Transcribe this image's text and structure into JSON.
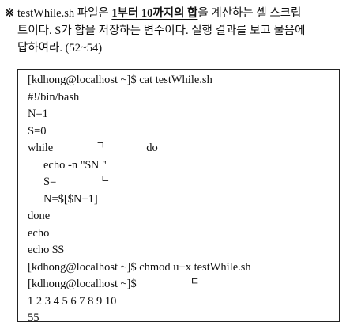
{
  "question": {
    "mark": "※",
    "line1_pre": "testWhile.sh 파일은 ",
    "line1_emph": "1부터 10까지의 합",
    "line1_post": "을 계산하는 셸 스크립",
    "line2": "트이다. S가 합을 저장하는 변수이다. 실행 결과를 보고 물음에",
    "line3": "답하여라. (52~54)"
  },
  "code": {
    "line1": "[kdhong@localhost ~]$ cat testWhile.sh",
    "line2": "#!/bin/bash",
    "line3": "N=1",
    "line4": "S=0",
    "while_kw": "while",
    "blank1": "ㄱ",
    "do_kw": "do",
    "echo_line": "echo -n \"$N \"",
    "s_assign": "S=",
    "blank2": "ㄴ",
    "n_line": "N=$[$N+1]",
    "done": "done",
    "echo1": "echo",
    "echo_s": "echo $S",
    "chmod_line": "[kdhong@localhost ~]$ chmod u+x testWhile.sh",
    "prompt_last": "[kdhong@localhost ~]$",
    "blank3": "ㄷ",
    "output1": "1 2 3 4 5 6 7 8 9 10",
    "output2": "55"
  }
}
